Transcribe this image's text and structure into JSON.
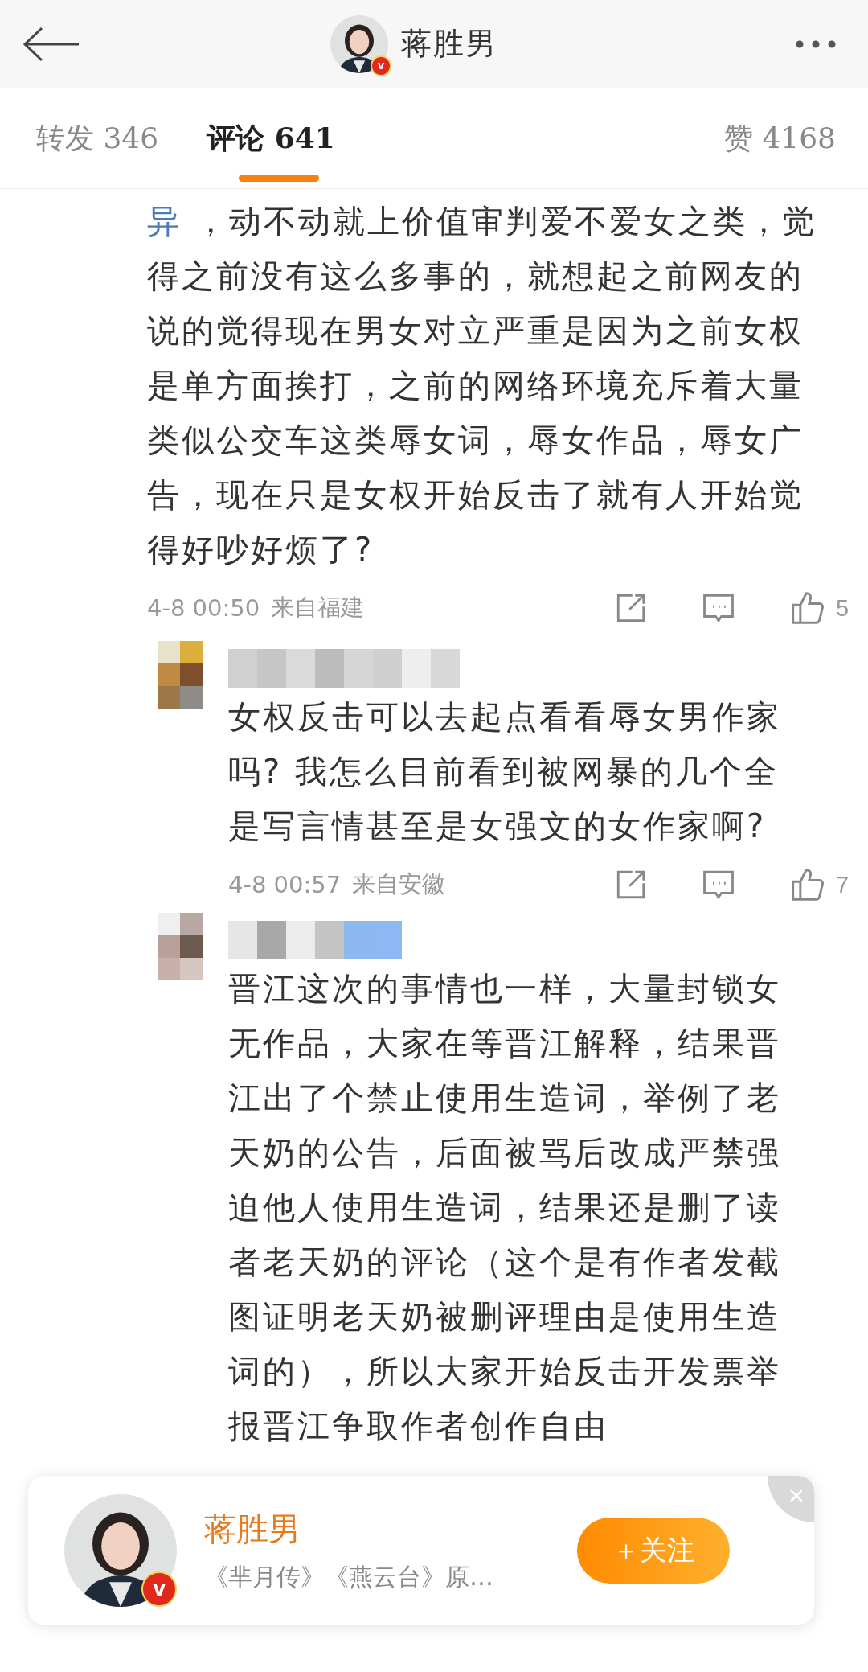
{
  "header": {
    "title": "蒋胜男",
    "badge": "v"
  },
  "tabs": [
    {
      "label": "转发",
      "count": "346",
      "selected": false
    },
    {
      "label": "评论",
      "count": "641",
      "selected": true
    },
    {
      "label": "赞",
      "count": "4168",
      "selected": false
    }
  ],
  "comment": {
    "link": "异",
    "text": " ，动不动就上价值审判爱不爱女之类，觉得之前没有这么多事的，就想起之前网友的说的觉得现在男女对立严重是因为之前女权是单方面挨打，之前的网络环境充斥着大量类似公交车这类辱女词，辱女作品，辱女广告，现在只是女权开始反击了就有人开始觉得好吵好烦了?",
    "time": "4-8 00:50",
    "location": "来自福建",
    "likes": "5"
  },
  "replies": [
    {
      "text": "女权反击可以去起点看看辱女男作家吗? 我怎么目前看到被网暴的几个全是写言情甚至是女强文的女作家啊?",
      "time": "4-8 00:57",
      "location": "来自安徽",
      "likes": "7"
    },
    {
      "text": "晋江这次的事情也一样，大量封锁女无作品，大家在等晋江解释，结果晋江出了个禁止使用生造词，举例了老天奶的公告，后面被骂后改成严禁强迫他人使用生造词，结果还是删了读者老天奶的评论（这个是有作者发截图证明老天奶被删评理由是使用生造词的），所以大家开始反击开发票举报晋江争取作者创作自由"
    }
  ],
  "follow_card": {
    "name": "蒋胜男",
    "badge": "v",
    "subtitle": "《芈月传》《燕云台》原…",
    "button": "＋关注",
    "close": "×"
  }
}
